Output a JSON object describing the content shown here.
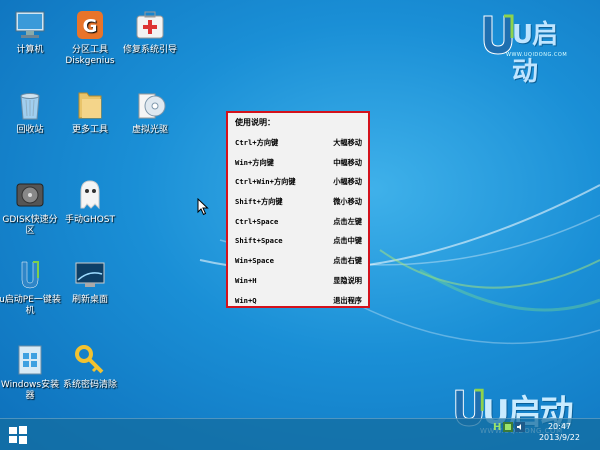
{
  "desktop": {
    "icons": [
      {
        "label": "计算机",
        "icon": "computer-icon"
      },
      {
        "label": "分区工具\nDiskgenius",
        "icon": "diskgenius-icon"
      },
      {
        "label": "修复系统引导",
        "icon": "repair-boot-icon"
      },
      {
        "label": "回收站",
        "icon": "recycle-bin-icon"
      },
      {
        "label": "更多工具",
        "icon": "folder-icon"
      },
      {
        "label": "虚拟光驱",
        "icon": "virtual-drive-icon"
      },
      {
        "label": "GDISK快速分区",
        "icon": "gdisk-icon"
      },
      {
        "label": "手动GHOST",
        "icon": "ghost-icon"
      },
      {
        "label": "u启动PE一键装机",
        "icon": "pe-install-icon"
      },
      {
        "label": "刷新桌面",
        "icon": "refresh-desktop-icon"
      },
      {
        "label": "Windows安装器",
        "icon": "windows-installer-icon"
      },
      {
        "label": "系统密码清除",
        "icon": "key-icon"
      }
    ]
  },
  "logo": {
    "text": "U启动",
    "url": "WWW.UQIDONG.COM"
  },
  "help": {
    "title": "使用说明：",
    "rows": [
      {
        "key": "Ctrl+方向键",
        "action": "大幅移动"
      },
      {
        "key": "Win+方向键",
        "action": "中幅移动"
      },
      {
        "key": "Ctrl+Win+方向键",
        "action": "小幅移动"
      },
      {
        "key": "Shift+方向键",
        "action": "微小移动"
      },
      {
        "key": "Ctrl+Space",
        "action": "点击左键"
      },
      {
        "key": "Shift+Space",
        "action": "点击中键"
      },
      {
        "key": "Win+Space",
        "action": "点击右键"
      },
      {
        "key": "Win+H",
        "action": "显隐说明"
      },
      {
        "key": "Win+Q",
        "action": "退出程序"
      }
    ]
  },
  "taskbar": {
    "start_icon": "windows-start-icon",
    "tray": {
      "ime": "H",
      "time": "20:47",
      "date": "2013/9/22"
    }
  },
  "colors": {
    "accent": "#d4121c",
    "desktop": "#1a8fd6"
  }
}
